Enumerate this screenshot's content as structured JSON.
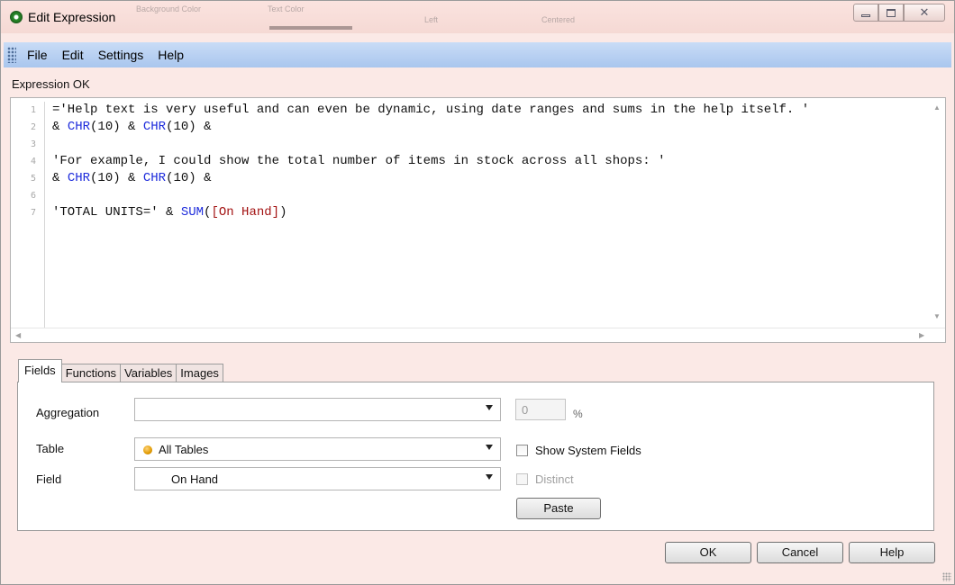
{
  "window": {
    "title": "Edit Expression"
  },
  "background_ghost": [
    "Background Color",
    "Text Color",
    "Left",
    "Centered"
  ],
  "menu": [
    "File",
    "Edit",
    "Settings",
    "Help"
  ],
  "status": "Expression OK",
  "editor": {
    "line_numbers": [
      "1",
      "2",
      "3",
      "4",
      "5",
      "6",
      "7"
    ],
    "lines": [
      [
        {
          "t": "='Help text is very useful and can even be dynamic, using date ranges and sums in the help itself. '",
          "k": "txt"
        }
      ],
      [
        {
          "t": "& ",
          "k": "txt"
        },
        {
          "t": "CHR",
          "k": "fn"
        },
        {
          "t": "(10) & ",
          "k": "txt"
        },
        {
          "t": "CHR",
          "k": "fn"
        },
        {
          "t": "(10) &",
          "k": "txt"
        }
      ],
      [],
      [
        {
          "t": "'For example, I could show the total number of items in stock across all shops: '",
          "k": "txt"
        }
      ],
      [
        {
          "t": "& ",
          "k": "txt"
        },
        {
          "t": "CHR",
          "k": "fn"
        },
        {
          "t": "(10) & ",
          "k": "txt"
        },
        {
          "t": "CHR",
          "k": "fn"
        },
        {
          "t": "(10) &",
          "k": "txt"
        }
      ],
      [],
      [
        {
          "t": "'TOTAL UNITS=' & ",
          "k": "txt"
        },
        {
          "t": "SUM",
          "k": "fn"
        },
        {
          "t": "(",
          "k": "txt"
        },
        {
          "t": "[On Hand]",
          "k": "fld"
        },
        {
          "t": ")",
          "k": "txt"
        }
      ]
    ]
  },
  "tabs": [
    "Fields",
    "Functions",
    "Variables",
    "Images"
  ],
  "fields_panel": {
    "aggregation_label": "Aggregation",
    "aggregation_value": "",
    "percent_value": "0",
    "percent_sign": "%",
    "table_label": "Table",
    "table_value": "All Tables",
    "show_system_fields": "Show System Fields",
    "field_label": "Field",
    "field_value": "On Hand",
    "distinct": "Distinct",
    "paste": "Paste"
  },
  "buttons": {
    "ok": "OK",
    "cancel": "Cancel",
    "help": "Help"
  },
  "colors": {
    "menubar": "#b6cff2",
    "function": "#1d2bdb",
    "field": "#a31313",
    "titlebar": "#f7dcd8"
  }
}
